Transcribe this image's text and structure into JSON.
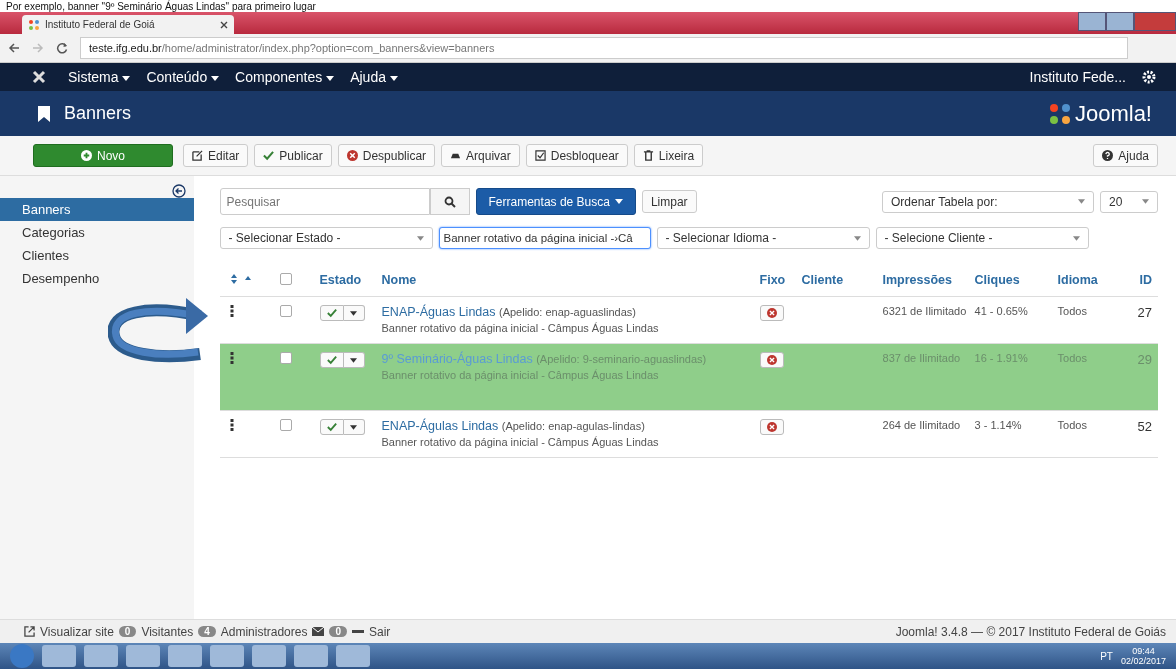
{
  "caption": "Por exemplo, banner \"9º Seminário Águas Lindas\" para primeiro lugar",
  "browser": {
    "tab_title": "Instituto Federal de Goiá",
    "url_host": "teste.ifg.edu.br",
    "url_path": "/home/administrator/index.php?option=com_banners&view=banners"
  },
  "nav": {
    "menus": [
      "Sistema",
      "Conteúdo",
      "Componentes",
      "Ajuda"
    ],
    "site": "Instituto Fede..."
  },
  "header": {
    "title": "Banners",
    "logo": "Joomla!"
  },
  "toolbar": {
    "primary": "Novo",
    "buttons": [
      {
        "kind": "edit",
        "label": "Editar"
      },
      {
        "kind": "publish",
        "label": "Publicar"
      },
      {
        "kind": "unpublish",
        "label": "Despublicar"
      },
      {
        "kind": "archive",
        "label": "Arquivar"
      },
      {
        "kind": "checkin",
        "label": "Desbloquear"
      },
      {
        "kind": "trash",
        "label": "Lixeira"
      }
    ],
    "help": "Ajuda"
  },
  "sidebar": {
    "items": [
      {
        "label": "Banners",
        "selected": true
      },
      {
        "label": "Categorias",
        "selected": false
      },
      {
        "label": "Clientes",
        "selected": false
      },
      {
        "label": "Desempenho",
        "selected": false
      }
    ]
  },
  "filters": {
    "search_placeholder": "Pesquisar",
    "tools": "Ferramentas de Busca",
    "clear": "Limpar",
    "ordering": "Ordenar Tabela por:",
    "limit": "20",
    "selects": [
      {
        "value": "- Selecionar Estado -",
        "focused": false
      },
      {
        "value": "Banner rotativo da página inicial -›Câ",
        "focused": true
      },
      {
        "value": "- Selecionar Idioma -",
        "focused": false
      },
      {
        "value": "- Selecione Cliente -",
        "focused": false
      }
    ]
  },
  "table": {
    "select_all_checked": false,
    "columns": [
      "Estado",
      "Nome",
      "Fixo",
      "Cliente",
      "Impressões",
      "Cliques",
      "Idioma",
      "ID"
    ],
    "rows": [
      {
        "name": "ENAP-Águas Lindas",
        "alias": "(Apelido: enap-aguaslindas)",
        "category": "Banner rotativo da página inicial - Câmpus Águas Lindas",
        "impressions": "6321 de Ilimitado",
        "clicks": "41 - 0.65%",
        "language": "Todos",
        "id": "27",
        "checked": false,
        "dragging": false
      },
      {
        "name": "9º Seminário-Águas Lindas",
        "alias": "(Apelido: 9-seminario-aguaslindas)",
        "category": "Banner rotativo da página inicial - Câmpus Águas Lindas",
        "impressions": "837 de Ilimitado",
        "clicks": "16 - 1.91%",
        "language": "Todos",
        "id": "29",
        "checked": false,
        "dragging": true
      },
      {
        "name": "ENAP-Águlas Lindas",
        "alias": "(Apelido: enap-agulas-lindas)",
        "category": "Banner rotativo da página inicial - Câmpus Águas Lindas",
        "impressions": "264 de Ilimitado",
        "clicks": "3 - 1.14%",
        "language": "Todos",
        "id": "52",
        "checked": false,
        "dragging": false
      }
    ]
  },
  "footer": {
    "view_site": "Visualizar site",
    "visitors_count": "0",
    "visitors": "Visitantes",
    "admins_count": "4",
    "admins": "Administradores",
    "messages_count": "0",
    "logout": "Sair",
    "version": "Joomla! 3.4.8 — © 2017 Instituto Federal de Goiás"
  },
  "taskbar": {
    "lang": "PT",
    "time": "09:44",
    "date": "02/02/2017"
  }
}
